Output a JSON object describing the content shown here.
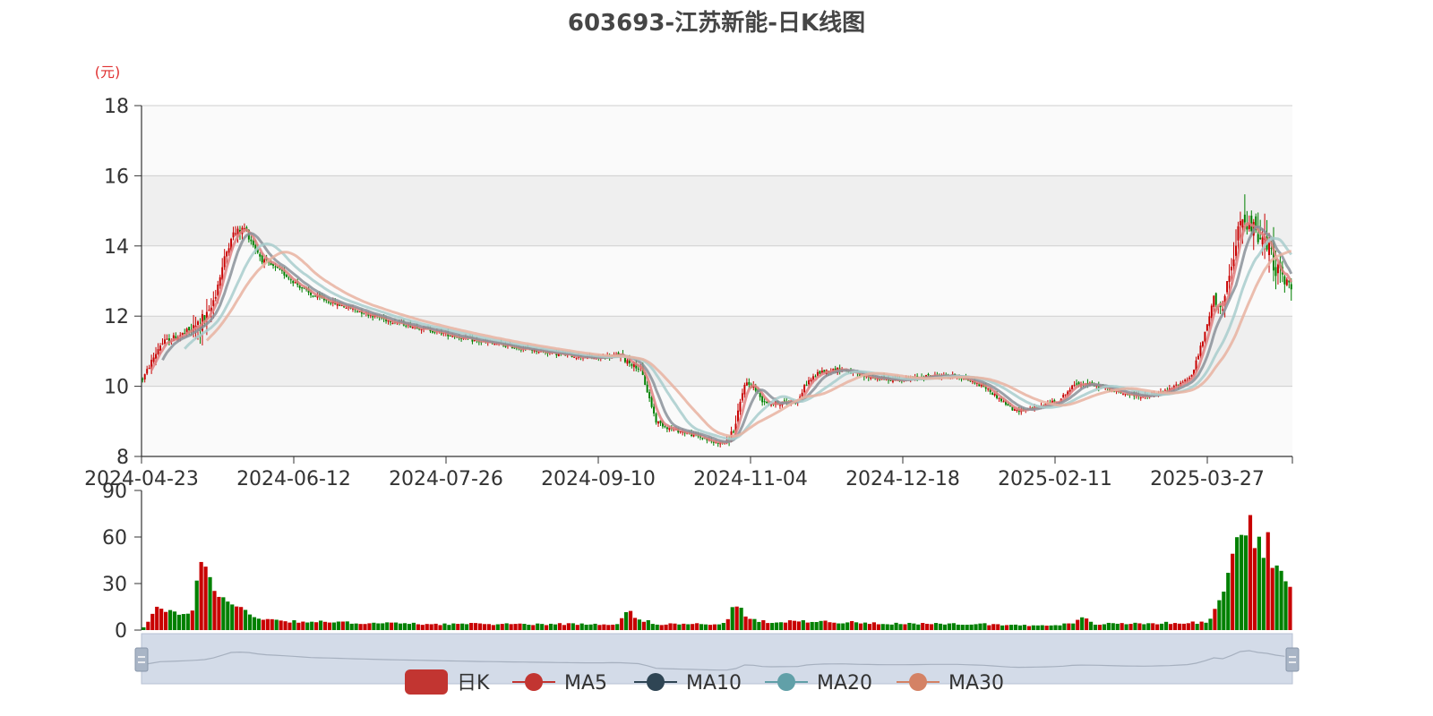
{
  "chart_data": {
    "type": "candlestick",
    "title": "603693-江苏新能-日K线图",
    "price_unit": "(元)",
    "price_axis": {
      "min": 8,
      "max": 18,
      "ticks": [
        "8",
        "10",
        "12",
        "14",
        "16",
        "18"
      ]
    },
    "volume_axis": {
      "min": 0,
      "max": 90,
      "ticks": [
        "0",
        "30",
        "60",
        "90"
      ]
    },
    "x_tick_labels": [
      "2024-04-23",
      "2024-06-12",
      "2024-07-26",
      "2024-09-10",
      "2024-11-04",
      "2024-12-18",
      "2025-02-11",
      "2025-03-27"
    ],
    "legend": [
      {
        "name": "日K",
        "color": "#c23531"
      },
      {
        "name": "MA5",
        "color": "#c23531"
      },
      {
        "name": "MA10",
        "color": "#2f4554"
      },
      {
        "name": "MA20",
        "color": "#61a0a8"
      },
      {
        "name": "MA30",
        "color": "#d48265"
      }
    ],
    "colors": {
      "up": "#c80000",
      "down": "#008000",
      "ma5": "#e08080",
      "ma10": "#8a9099",
      "ma20": "#a8cccc",
      "ma30": "#e7b2a0"
    },
    "price_path": [
      [
        0,
        10.2
      ],
      [
        8,
        11.2
      ],
      [
        22,
        11.6
      ],
      [
        30,
        12.0
      ],
      [
        40,
        14.3
      ],
      [
        46,
        14.5
      ],
      [
        54,
        13.6
      ],
      [
        64,
        13.2
      ],
      [
        76,
        12.6
      ],
      [
        90,
        12.3
      ],
      [
        110,
        11.9
      ],
      [
        130,
        11.6
      ],
      [
        150,
        11.3
      ],
      [
        170,
        11.1
      ],
      [
        190,
        10.9
      ],
      [
        205,
        10.8
      ],
      [
        215,
        10.9
      ],
      [
        225,
        10.5
      ],
      [
        232,
        9.0
      ],
      [
        238,
        8.8
      ],
      [
        250,
        8.6
      ],
      [
        258,
        8.4
      ],
      [
        264,
        8.4
      ],
      [
        268,
        8.9
      ],
      [
        272,
        10.1
      ],
      [
        276,
        10.0
      ],
      [
        280,
        9.6
      ],
      [
        284,
        9.5
      ],
      [
        296,
        9.6
      ],
      [
        300,
        10.1
      ],
      [
        306,
        10.4
      ],
      [
        316,
        10.5
      ],
      [
        324,
        10.3
      ],
      [
        336,
        10.2
      ],
      [
        346,
        10.2
      ],
      [
        356,
        10.3
      ],
      [
        368,
        10.3
      ],
      [
        380,
        10.0
      ],
      [
        388,
        9.6
      ],
      [
        394,
        9.3
      ],
      [
        404,
        9.4
      ],
      [
        414,
        9.6
      ],
      [
        422,
        10.1
      ],
      [
        432,
        10.0
      ],
      [
        442,
        9.8
      ],
      [
        454,
        9.7
      ],
      [
        464,
        9.9
      ],
      [
        474,
        10.3
      ],
      [
        480,
        11.5
      ],
      [
        484,
        12.5
      ],
      [
        488,
        12.2
      ],
      [
        492,
        13.3
      ],
      [
        496,
        14.6
      ],
      [
        500,
        14.9
      ],
      [
        504,
        14.3
      ],
      [
        508,
        14.0
      ],
      [
        512,
        13.4
      ],
      [
        516,
        13.0
      ],
      [
        519,
        12.8
      ]
    ],
    "volume_path": [
      [
        0,
        2
      ],
      [
        6,
        15
      ],
      [
        10,
        12
      ],
      [
        16,
        10
      ],
      [
        22,
        14
      ],
      [
        26,
        45
      ],
      [
        30,
        36
      ],
      [
        36,
        20
      ],
      [
        44,
        14
      ],
      [
        52,
        8
      ],
      [
        64,
        6
      ],
      [
        90,
        5
      ],
      [
        130,
        4
      ],
      [
        170,
        4
      ],
      [
        205,
        4
      ],
      [
        214,
        4
      ],
      [
        218,
        14
      ],
      [
        222,
        8
      ],
      [
        232,
        4
      ],
      [
        262,
        4
      ],
      [
        268,
        18
      ],
      [
        272,
        8
      ],
      [
        282,
        5
      ],
      [
        300,
        6
      ],
      [
        322,
        5
      ],
      [
        350,
        4
      ],
      [
        380,
        4
      ],
      [
        400,
        3
      ],
      [
        420,
        4
      ],
      [
        424,
        8
      ],
      [
        430,
        4
      ],
      [
        480,
        5
      ],
      [
        484,
        12
      ],
      [
        488,
        30
      ],
      [
        492,
        50
      ],
      [
        496,
        62
      ],
      [
        500,
        70
      ],
      [
        504,
        60
      ],
      [
        508,
        55
      ],
      [
        512,
        40
      ],
      [
        516,
        28
      ],
      [
        519,
        25
      ]
    ]
  }
}
